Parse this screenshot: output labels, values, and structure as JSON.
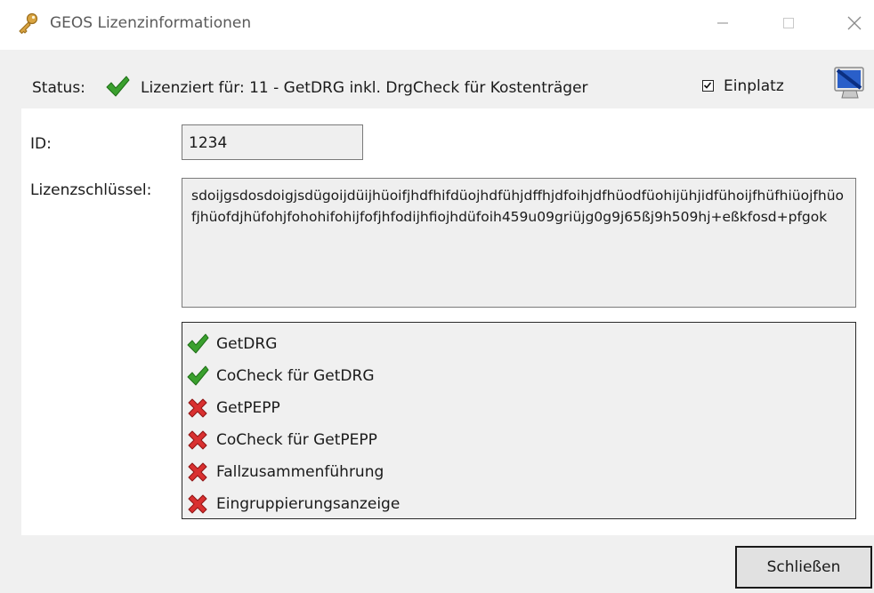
{
  "window": {
    "title": "GEOS Lizenzinformationen",
    "icon": "key-icon"
  },
  "status": {
    "label": "Status:",
    "icon": "checkmark-icon",
    "licensed_for": "Lizenziert für:  11 - GetDRG inkl. DrgCheck für Kostenträger",
    "einplatz_label": "Einplatz",
    "einplatz_checked": true
  },
  "fields": {
    "id_label": "ID:",
    "id_value": "1234",
    "key_label": "Lizenzschlüssel:",
    "key_value": "sdoijgsdosdoigjsdügoijdüijhüoifjhdfhifdüojhdfühjdffhjdfoihjdfhüodfüohijühjidfühoijfhüfhiüojfhüofjhüofdjhüfohjfohohifohijfofjhfodijhfiojhdüfoih459u09griüjg0g9j65ßj9h509hj+eßkfosd+pfgok"
  },
  "modules": [
    {
      "label": "GetDRG",
      "enabled": true
    },
    {
      "label": "CoCheck für GetDRG",
      "enabled": true
    },
    {
      "label": "GetPEPP",
      "enabled": false
    },
    {
      "label": "CoCheck für GetPEPP",
      "enabled": false
    },
    {
      "label": "Fallzusammenführung",
      "enabled": false
    },
    {
      "label": "Eingruppierungsanzeige",
      "enabled": false
    }
  ],
  "buttons": {
    "close_label": "Schließen"
  },
  "colors": {
    "check_green": "#3aa02e",
    "cross_red": "#d93030",
    "monitor_blue": "#2a5fc9"
  }
}
